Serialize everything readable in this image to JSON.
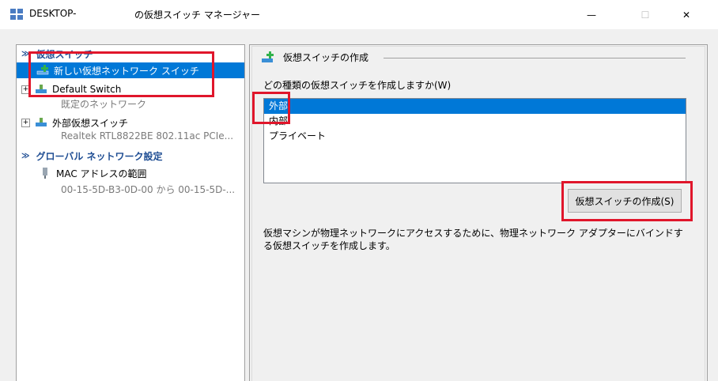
{
  "window": {
    "title_left": "DESKTOP-",
    "title_right": "の仮想スイッチ マネージャー",
    "minimize_glyph": "—",
    "maximize_glyph": "☐",
    "close_glyph": "✕"
  },
  "left_pane": {
    "sections": [
      {
        "label": "仮想スイッチ",
        "chevron": "≫"
      },
      {
        "label": "グローバル ネットワーク設定",
        "chevron": "≫"
      }
    ],
    "items": [
      {
        "label": "新しい仮想ネットワーク スイッチ",
        "selected": true,
        "icon": "new-switch-icon"
      },
      {
        "label": "Default Switch",
        "sublabel": "既定のネットワーク",
        "expander": "+",
        "icon": "network-switch-icon"
      },
      {
        "label": "外部仮想スイッチ",
        "sublabel": "Realtek RTL8822BE 802.11ac PCIe...",
        "expander": "+",
        "icon": "network-switch-icon"
      },
      {
        "label": "MAC アドレスの範囲",
        "sublabel": "00-15-5D-B3-0D-00 から 00-15-5D-...",
        "icon": "mac-address-icon"
      }
    ]
  },
  "right_pane": {
    "title": "仮想スイッチの作成",
    "question": "どの種類の仮想スイッチを作成しますか(W)",
    "types": [
      {
        "label": "外部",
        "selected": true
      },
      {
        "label": "内部",
        "selected": false
      },
      {
        "label": "プライベート",
        "selected": false
      }
    ],
    "create_button": "仮想スイッチの作成(S)",
    "description": "仮想マシンが物理ネットワークにアクセスするために、物理ネットワーク アダプターにバインドする仮想スイッチを作成します。"
  },
  "colors": {
    "selection": "#0078d7",
    "section_header": "#1e4d93",
    "highlight_box": "#e0162b"
  }
}
